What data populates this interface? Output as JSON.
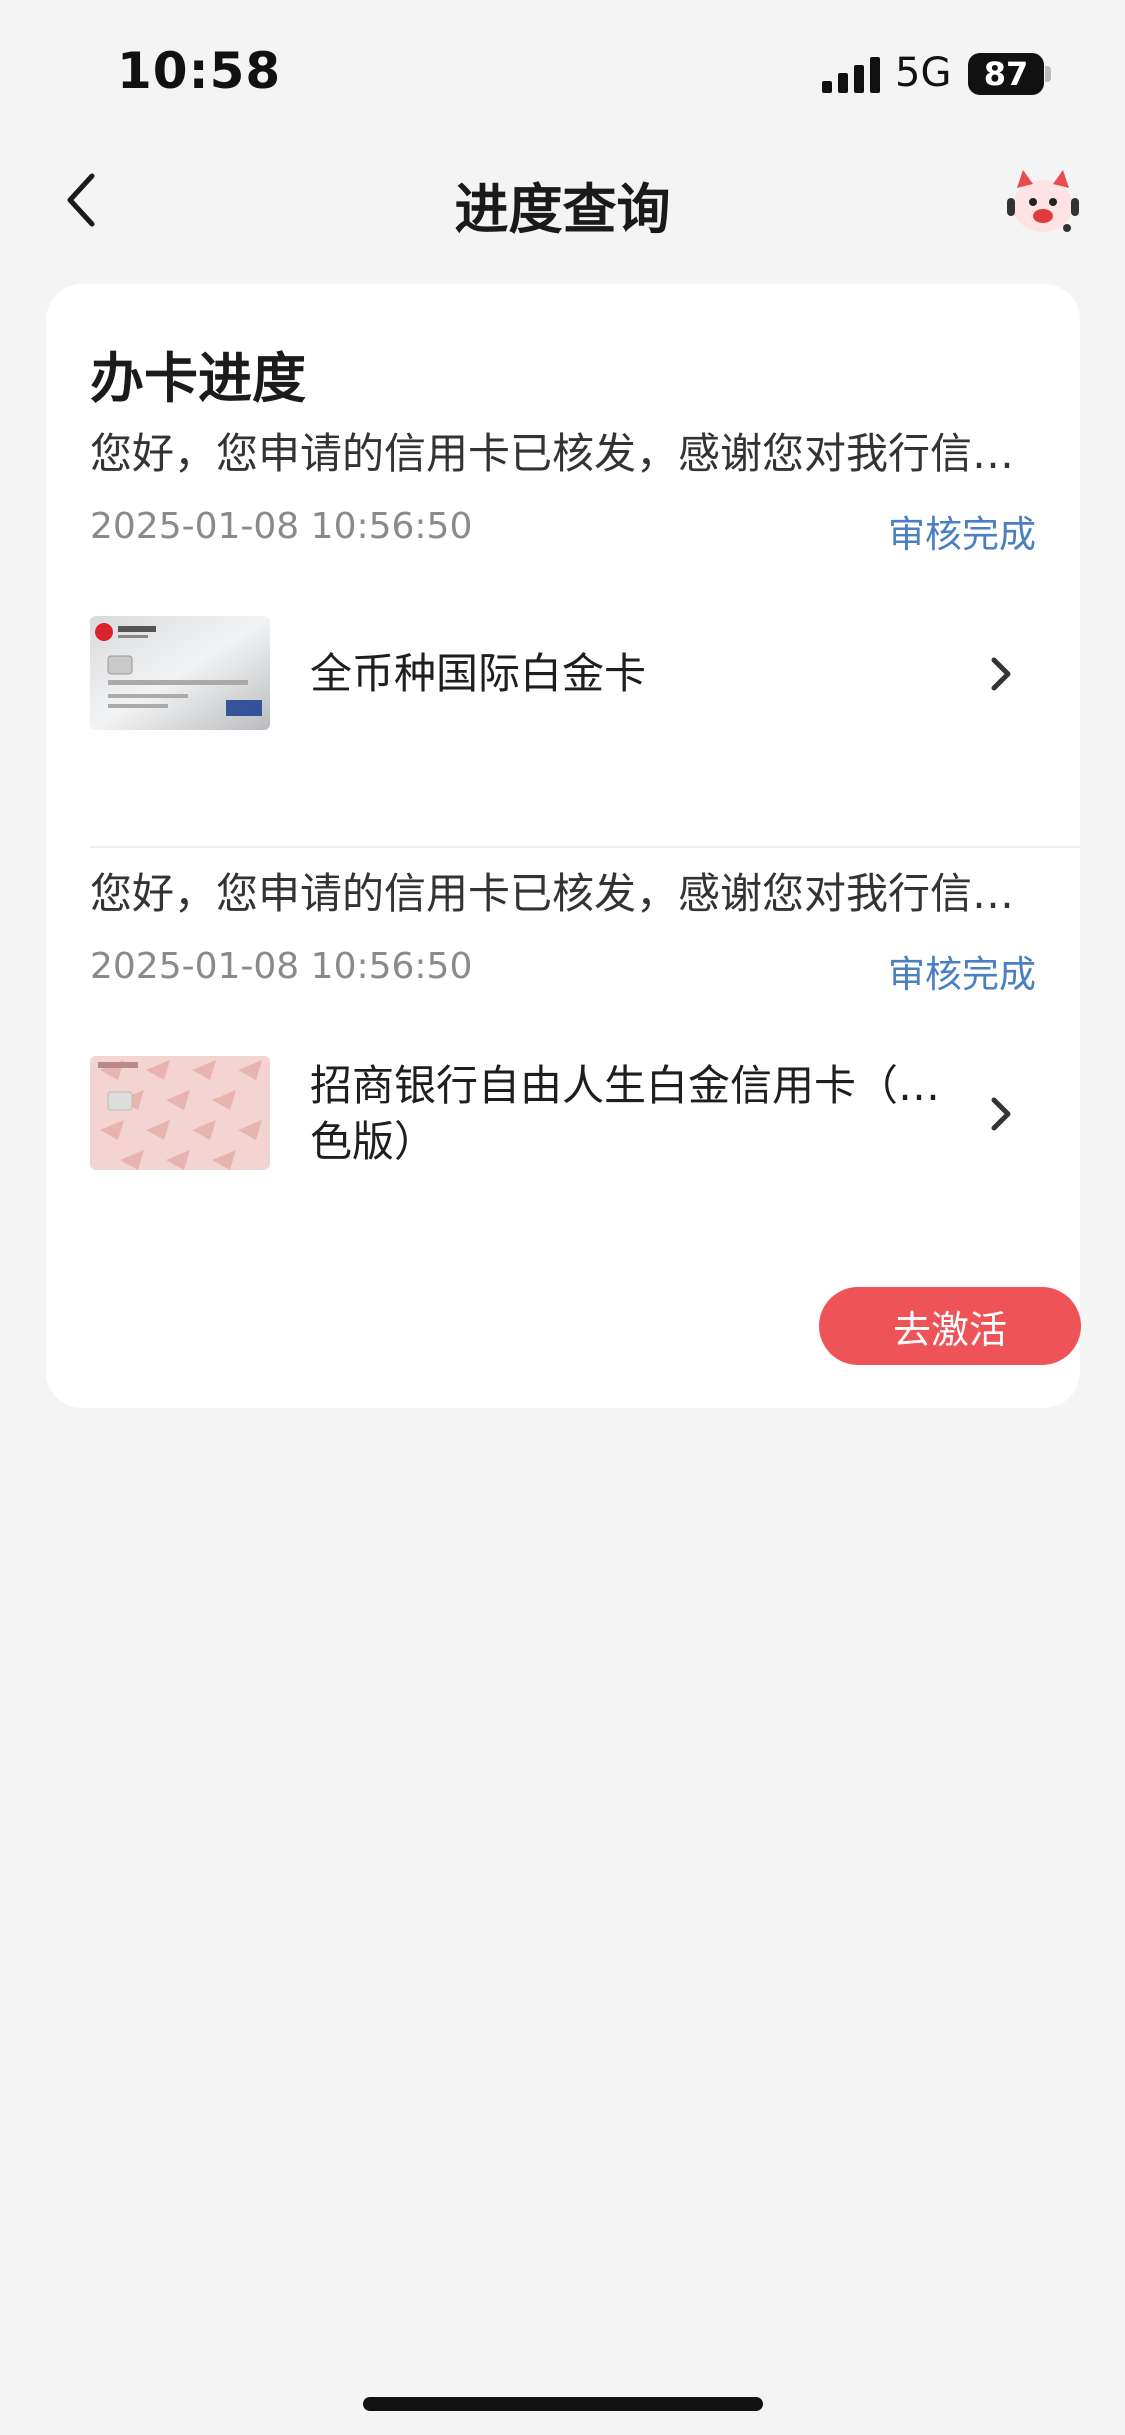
{
  "status_bar": {
    "time": "10:58",
    "network": "5G",
    "battery": "87"
  },
  "nav": {
    "title": "进度查询",
    "back_icon": "chevron-left-icon",
    "assistant_icon": "assistant-mascot-icon"
  },
  "section": {
    "title": "办卡进度"
  },
  "records": [
    {
      "message": "您好，您申请的信用卡已核发，感谢您对我行信…",
      "date": "2025-01-08 10:56:50",
      "status": "审核完成",
      "card_name": "全币种国际白金卡"
    },
    {
      "message": "您好，您申请的信用卡已核发，感谢您对我行信…",
      "date": "2025-01-08 10:56:50",
      "status": "审核完成",
      "card_name_line1": "招商银行自由人生白金信用卡（…",
      "card_name_line2": "色版）"
    }
  ],
  "actions": {
    "activate_label": "去激活"
  },
  "colors": {
    "accent_red": "#ee5357",
    "status_blue": "#4a7fc1",
    "background": "#f4f4f4"
  }
}
